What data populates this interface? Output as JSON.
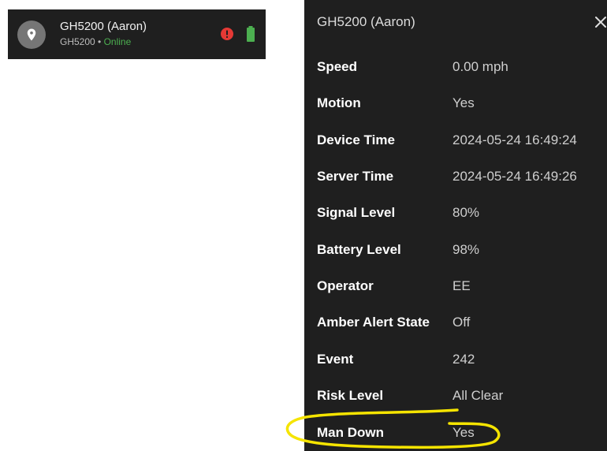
{
  "device_item": {
    "name": "GH5200 (Aaron)",
    "model": "GH5200",
    "separator": " • ",
    "status": "Online",
    "icons": {
      "avatar": "map-pin-icon",
      "alert": "alert-circle-icon",
      "battery": "battery-full-icon"
    },
    "colors": {
      "status_online": "#4caf50",
      "alert": "#e53935",
      "battery": "#4caf50"
    }
  },
  "popup": {
    "title": "GH5200 (Aaron)",
    "close_icon": "close-icon",
    "attributes": [
      {
        "name": "Speed",
        "value": "0.00 mph"
      },
      {
        "name": "Motion",
        "value": "Yes"
      },
      {
        "name": "Device Time",
        "value": "2024-05-24 16:49:24"
      },
      {
        "name": "Server Time",
        "value": "2024-05-24 16:49:26"
      },
      {
        "name": "Signal Level",
        "value": "80%"
      },
      {
        "name": "Battery Level",
        "value": "98%"
      },
      {
        "name": "Operator",
        "value": "EE"
      },
      {
        "name": "Amber Alert State",
        "value": "Off"
      },
      {
        "name": "Event",
        "value": "242"
      },
      {
        "name": "Risk Level",
        "value": "All Clear"
      },
      {
        "name": "Man Down",
        "value": "Yes"
      }
    ]
  },
  "annotation": {
    "color": "#f5e400"
  }
}
